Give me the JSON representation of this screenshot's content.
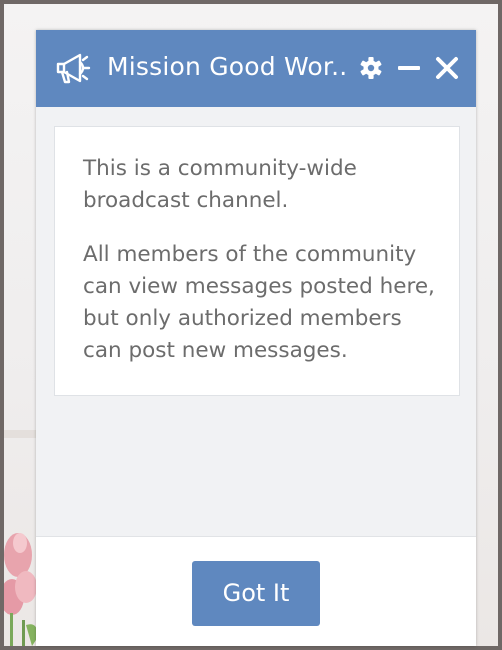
{
  "channel": {
    "title": "Mission Good Wor...",
    "icon": "megaphone-icon"
  },
  "header_actions": {
    "settings_icon": "gear-icon",
    "minimize_icon": "minus-icon",
    "close_icon": "close-icon"
  },
  "info": {
    "paragraph_1": "This is a community-wide broadcast channel.",
    "paragraph_2": "All members of the community can view messages posted here, but only authorized members can post new messages."
  },
  "footer": {
    "button_label": "Got It"
  },
  "colors": {
    "accent": "#5f88bf",
    "panel_background": "#f1f2f4",
    "text": "#6c6c6c"
  }
}
